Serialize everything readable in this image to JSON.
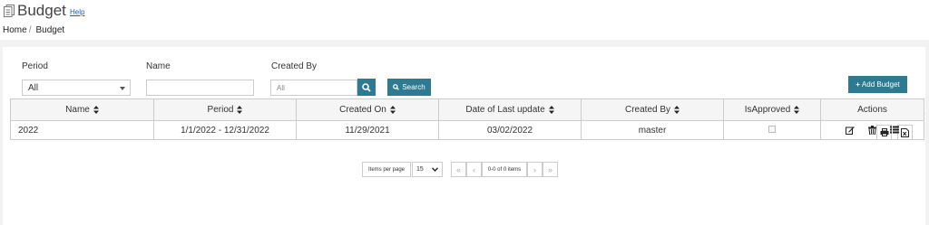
{
  "header": {
    "title": "Budget",
    "help": "Help"
  },
  "breadcrumb": {
    "home": "Home",
    "separator": "/",
    "current": "Budget"
  },
  "filters": {
    "period_label": "Period",
    "period_value": "All",
    "name_label": "Name",
    "name_value": "",
    "created_by_label": "Created By",
    "created_by_placeholder": "All",
    "search_label": "Search",
    "add_label": "Add Budget"
  },
  "table": {
    "columns": [
      "Name",
      "Period",
      "Created On",
      "Date of Last update",
      "Created By",
      "IsApproved",
      "Actions"
    ],
    "rows": [
      {
        "name": "2022",
        "period": "1/1/2022 - 12/31/2022",
        "created_on": "11/29/2021",
        "last_update": "03/02/2022",
        "created_by": "master",
        "approved": false
      }
    ]
  },
  "pager": {
    "items_per_page_label": "Items per page",
    "page_size": "15",
    "info": "0-0 of 0 items",
    "first": "«",
    "prev": "‹",
    "next": "›",
    "last": "»"
  },
  "colors": {
    "accent": "#2d7a91",
    "panel": "#ffffff",
    "background": "#f2f2f2"
  },
  "icons": [
    "page-icon",
    "caret-down-icon",
    "search-icon",
    "plus-icon",
    "print-icon",
    "excel-icon",
    "sort-icon",
    "edit-icon",
    "trash-icon",
    "list-icon",
    "chevron-down-icon"
  ]
}
